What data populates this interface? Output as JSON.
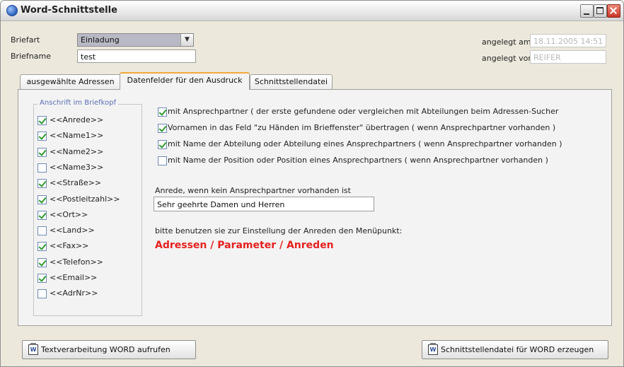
{
  "window": {
    "title": "Word-Schnittstelle"
  },
  "header": {
    "briefart_label": "Briefart",
    "briefart_value": "Einladung",
    "briefname_label": "Briefname",
    "briefname_value": "test",
    "angelegt_am_label": "angelegt am",
    "angelegt_am_value": "18.11.2005 14:51",
    "angelegt_von_label": "angelegt von",
    "angelegt_von_value": "REIFER"
  },
  "tabs": [
    {
      "label": "ausgewählte Adressen",
      "active": false
    },
    {
      "label": "Datenfelder für den Ausdruck",
      "active": true
    },
    {
      "label": "Schnittstellendatei",
      "active": false
    }
  ],
  "anschrift": {
    "title": "Anschrift im Briefkopf",
    "items": [
      {
        "label": "<<Anrede>>",
        "checked": true
      },
      {
        "label": "<<Name1>>",
        "checked": true
      },
      {
        "label": "<<Name2>>",
        "checked": true
      },
      {
        "label": "<<Name3>>",
        "checked": false
      },
      {
        "label": "<<Straße>>",
        "checked": true
      },
      {
        "label": "<<Postleitzahl>>",
        "checked": true
      },
      {
        "label": "<<Ort>>",
        "checked": true
      },
      {
        "label": "<<Land>>",
        "checked": false
      },
      {
        "label": "<<Fax>>",
        "checked": true
      },
      {
        "label": "<<Telefon>>",
        "checked": true
      },
      {
        "label": "<<Email>>",
        "checked": true
      },
      {
        "label": "<<AdrNr>>",
        "checked": false
      }
    ]
  },
  "options": [
    {
      "label": "mit Ansprechpartner ( der erste gefundene oder vergleichen mit Abteilungen beim Adressen-Sucher",
      "checked": true
    },
    {
      "label": "Vornamen in das Feld \"zu Händen im Brieffenster\" übertragen ( wenn Ansprechpartner vorhanden )",
      "checked": true
    },
    {
      "label": "mit Name der Abteilung oder Abteilung eines Ansprechpartners ( wenn Ansprechpartner vorhanden )",
      "checked": true
    },
    {
      "label": "mit Name der Position oder Position eines Ansprechpartners ( wenn Ansprechpartner vorhanden )",
      "checked": false
    }
  ],
  "anrede": {
    "label": "Anrede, wenn kein Ansprechpartner vorhanden ist",
    "value": "Sehr geehrte Damen und Herren"
  },
  "hint": {
    "text": "bitte benutzen sie zur Einstellung der Anreden den Menüpunkt:",
    "link": "Adressen / Parameter / Anreden"
  },
  "buttons": {
    "word_open": "Textverarbeitung WORD aufrufen",
    "create_file": "Schnittstellendatei für WORD erzeugen"
  },
  "colors": {
    "link_red": "#e5211f",
    "tab_accent": "#f3a93b",
    "group_title": "#5b6fb4"
  }
}
